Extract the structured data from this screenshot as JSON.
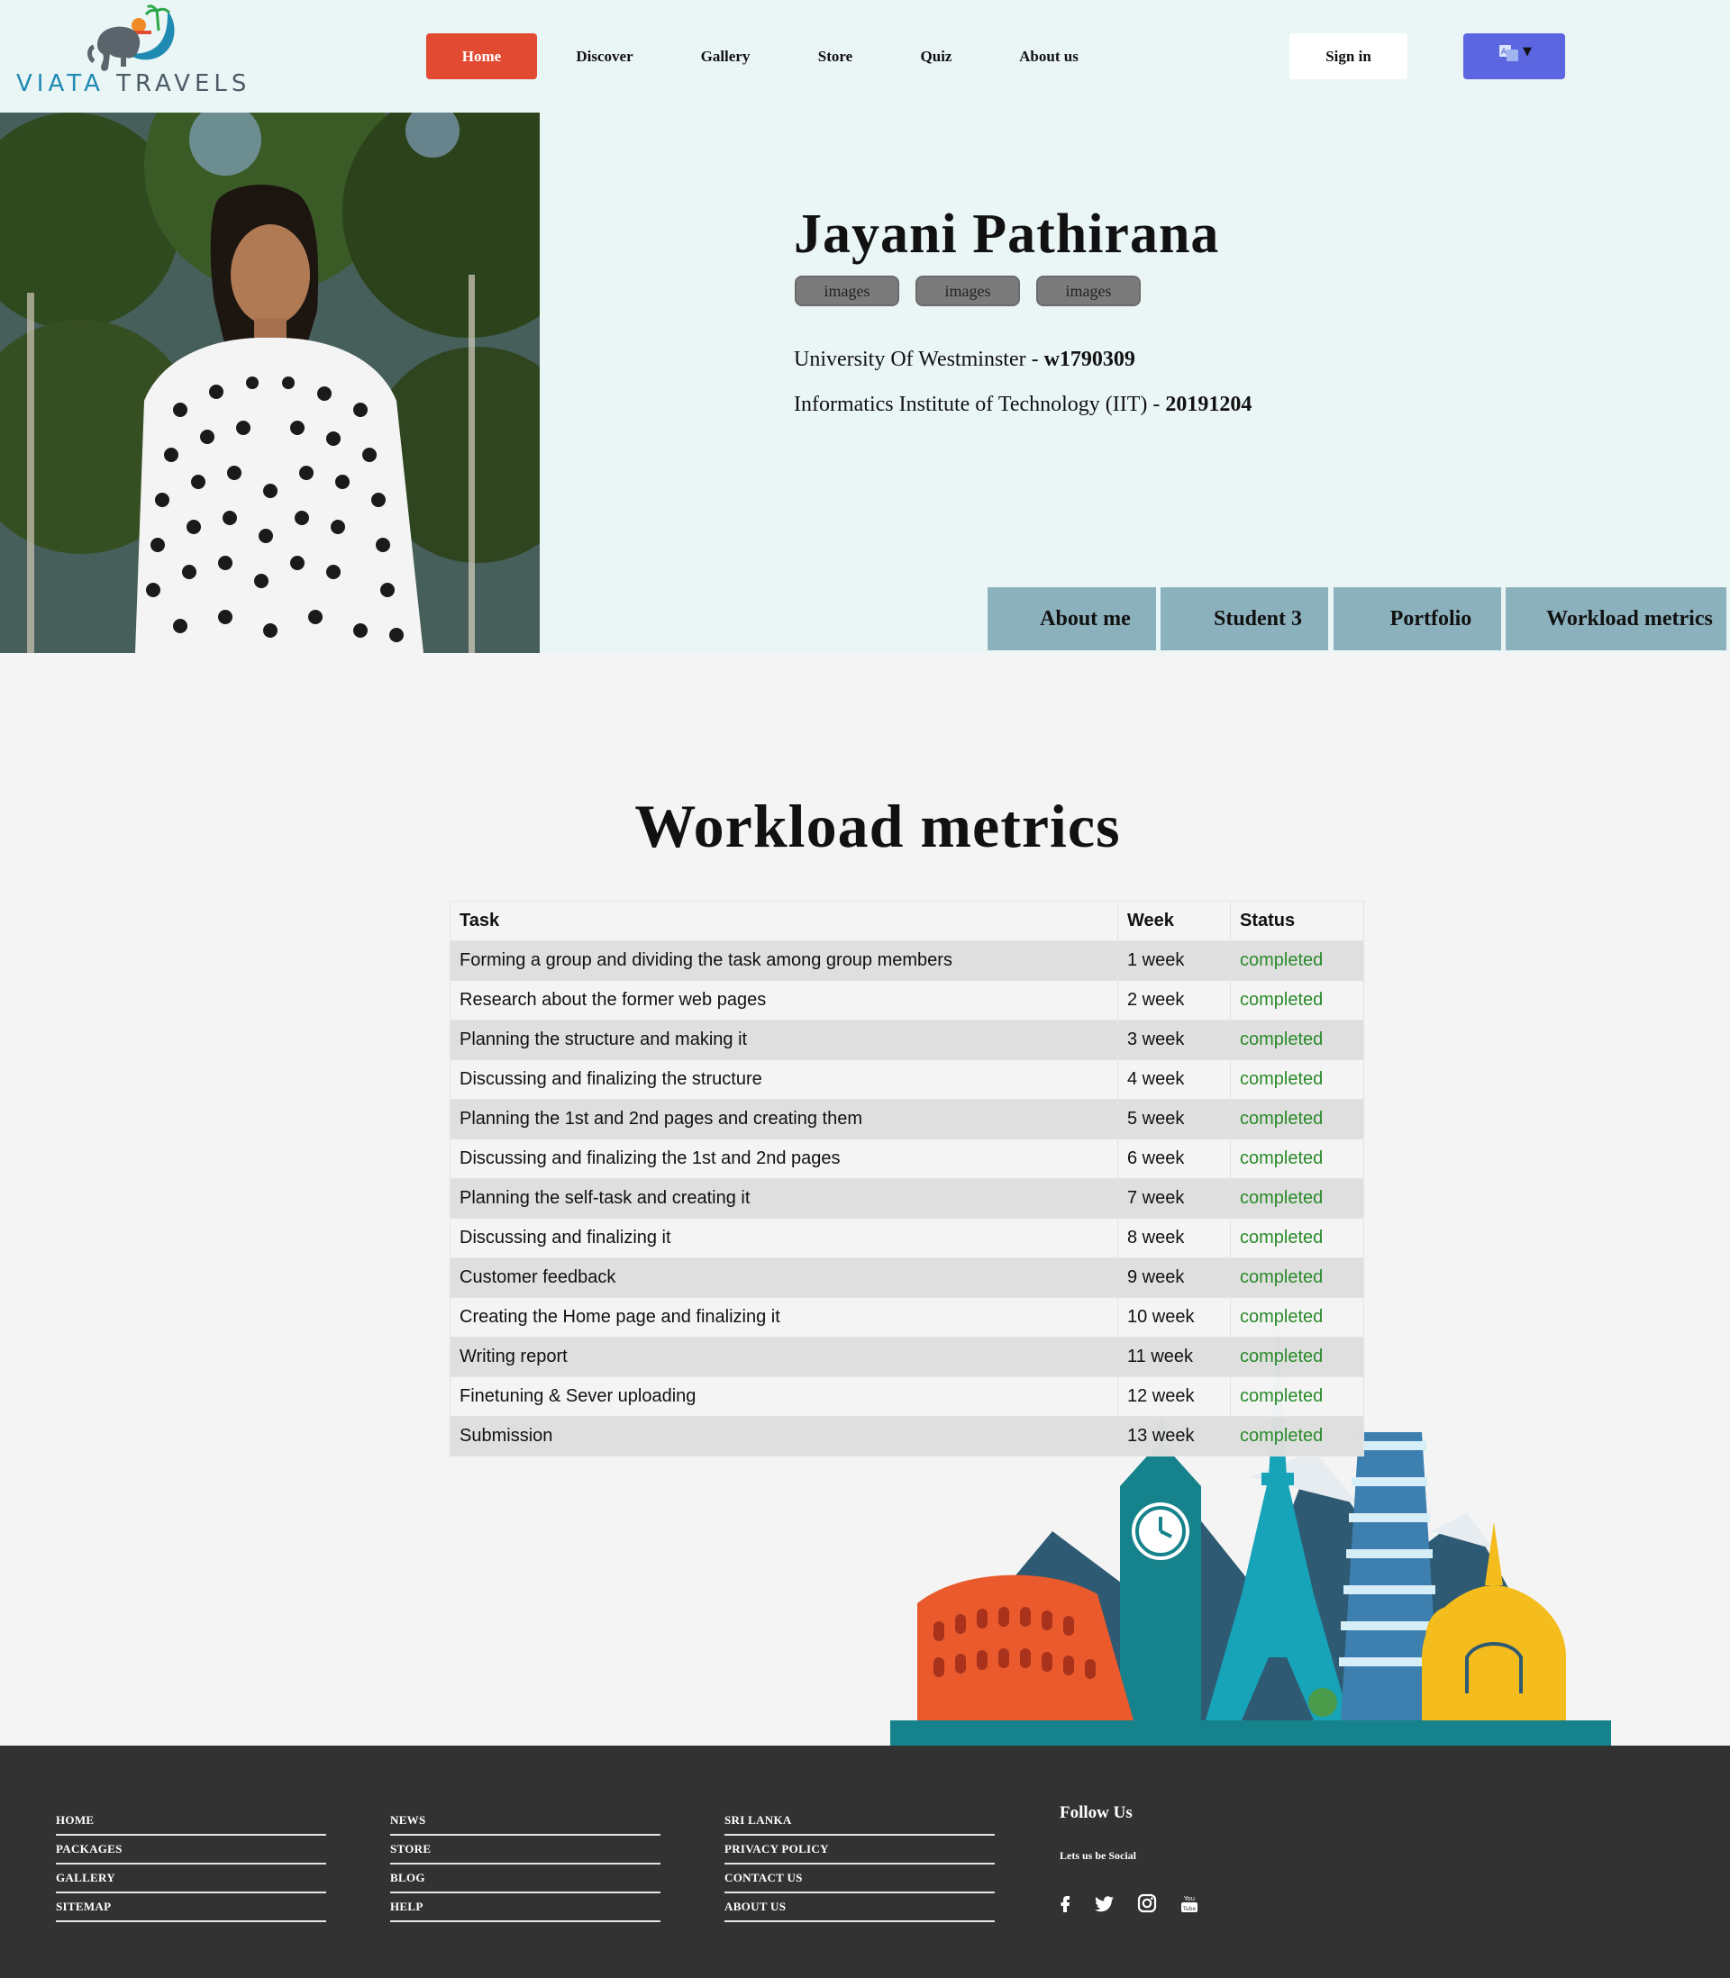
{
  "brand": {
    "word1": "VIATA",
    "word2": "TRAVELS"
  },
  "nav": {
    "items": [
      "Home",
      "Discover",
      "Gallery",
      "Store",
      "Quiz",
      "About us"
    ],
    "active": "Home",
    "signin": "Sign in"
  },
  "profile": {
    "name": "Jayani Pathirana",
    "tags": [
      "images",
      "images",
      "images"
    ],
    "university": "University Of Westminster - ",
    "university_id": "w1790309",
    "institute": "Informatics Institute of Technology (IIT) - ",
    "institute_id": "20191204"
  },
  "tabs": [
    "About me",
    "Student 3",
    "Portfolio",
    "Workload metrics"
  ],
  "workload": {
    "title": "Workload metrics",
    "columns": [
      "Task",
      "Week",
      "Status"
    ],
    "rows": [
      {
        "task": "Forming a group and dividing the task among group members",
        "week": "1 week",
        "status": "completed"
      },
      {
        "task": "Research about the former web pages",
        "week": "2 week",
        "status": "completed"
      },
      {
        "task": "Planning the structure and making it",
        "week": "3 week",
        "status": "completed"
      },
      {
        "task": "Discussing and finalizing the structure",
        "week": "4 week",
        "status": "completed"
      },
      {
        "task": "Planning the 1st and 2nd pages and creating them",
        "week": "5 week",
        "status": "completed"
      },
      {
        "task": "Discussing and finalizing the 1st and 2nd pages",
        "week": "6 week",
        "status": "completed"
      },
      {
        "task": "Planning the self-task and creating it",
        "week": "7 week",
        "status": "completed"
      },
      {
        "task": "Discussing and finalizing it",
        "week": "8 week",
        "status": "completed"
      },
      {
        "task": "Customer feedback",
        "week": "9 week",
        "status": "completed"
      },
      {
        "task": "Creating the Home page and finalizing it",
        "week": "10 week",
        "status": "completed"
      },
      {
        "task": "Writing report",
        "week": "11 week",
        "status": "completed"
      },
      {
        "task": "Finetuning & Sever uploading",
        "week": "12 week",
        "status": "completed"
      },
      {
        "task": "Submission",
        "week": "13 week",
        "status": "completed"
      }
    ]
  },
  "footer": {
    "col1": [
      "HOME",
      "PACKAGES",
      "GALLERY",
      "SITEMAP"
    ],
    "col2": [
      "NEWS",
      "STORE",
      "BLOG",
      "HELP"
    ],
    "col3": [
      "SRI LANKA",
      "PRIVACY POLICY",
      "CONTACT US",
      "ABOUT US"
    ],
    "follow_title": "Follow Us",
    "follow_sub": "Lets us be Social",
    "social": [
      "facebook-icon",
      "twitter-icon",
      "instagram-icon",
      "youtube-icon"
    ]
  },
  "colors": {
    "header_bg": "#eaf5f6",
    "nav_active": "#e24a32",
    "lang_button": "#5b66e0",
    "tab_bg": "#8bb1bd",
    "status_green": "#2a8a2a",
    "footer_bg": "#323232"
  }
}
